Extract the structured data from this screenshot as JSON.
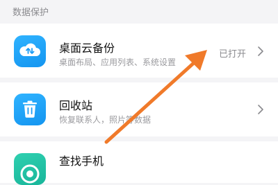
{
  "section": {
    "label": "数据保护"
  },
  "items": [
    {
      "title": "桌面云备份",
      "subtitle": "桌面布局、应用列表、系统设置",
      "status": "已打开",
      "icon": "cloud-backup-icon"
    },
    {
      "title": "回收站",
      "subtitle": "恢复联系人，照片等数据",
      "icon": "trash-bin-icon"
    },
    {
      "title": "查找手机",
      "icon": "find-phone-icon"
    }
  ],
  "colors": {
    "accent": "#1a9cf5",
    "arrow": "#f07a2a",
    "background": "#f4f4f6"
  }
}
